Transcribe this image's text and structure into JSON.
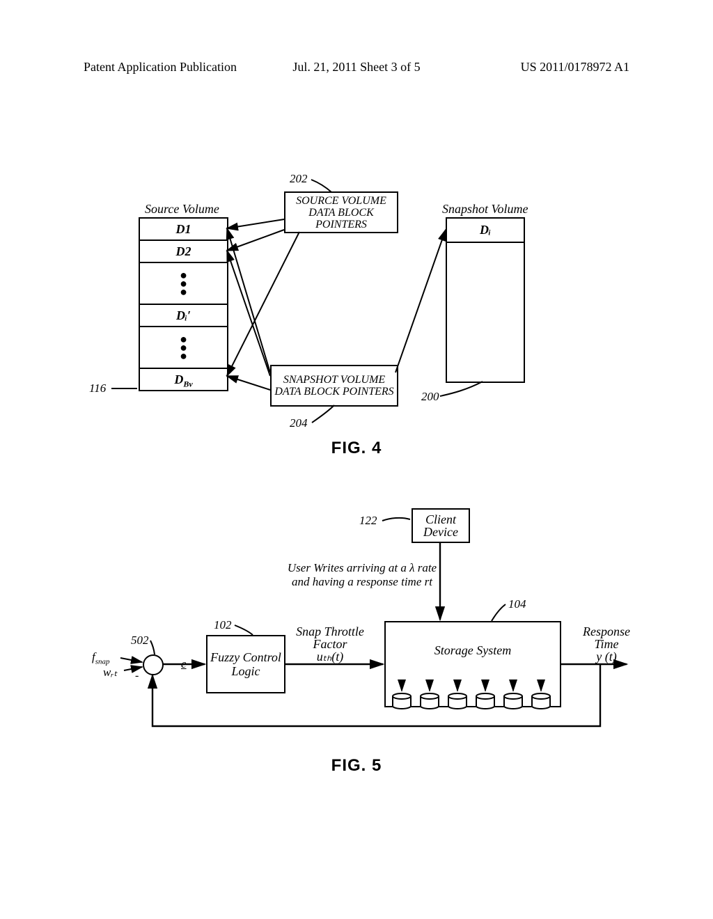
{
  "header": {
    "left": "Patent Application Publication",
    "center": "Jul. 21, 2011   Sheet 3 of 5",
    "right": "US 2011/0178972 A1"
  },
  "fig4": {
    "label": "FIG. 4",
    "sourceVolumeTitle": "Source Volume",
    "snapshotVolumeTitle": "Snapshot Volume",
    "ptrBox1": "SOURCE VOLUME DATA BLOCK POINTERS",
    "ptrBox2": "SNAPSHOT VOLUME DATA BLOCK POINTERS",
    "ref116": "116",
    "ref200": "200",
    "ref202": "202",
    "ref204": "204",
    "cells": {
      "d1": "D1",
      "d2": "D2",
      "dip": "Dᵢ′",
      "dbv": "D_Bv",
      "di_snap": "Dᵢ"
    }
  },
  "fig5": {
    "label": "FIG. 5",
    "clientDevice": "Client Device",
    "userWritesLine1": "User Writes arriving at a λ rate",
    "userWritesLine2": "and having a response time rt",
    "fuzzy": "Fuzzy Control Logic",
    "snapThrottleTitle": "Snap Throttle Factor",
    "snapThrottleSym": "uₜₕ(t)",
    "storage": "Storage System",
    "responseTimeTitle": "Response Time",
    "responseTimeSym": "y (t)",
    "fsnap": "f_snap",
    "wrt": "wᵣₜ",
    "e": "e",
    "minus": "-",
    "ref102": "102",
    "ref104": "104",
    "ref122": "122",
    "ref502": "502"
  }
}
